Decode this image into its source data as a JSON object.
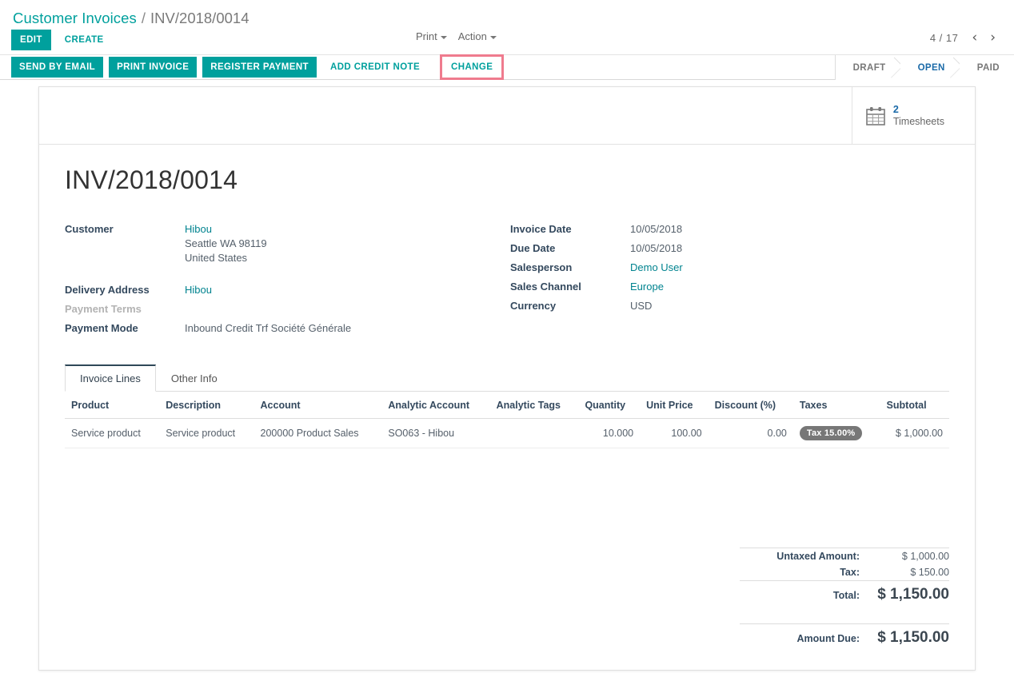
{
  "breadcrumb": {
    "root": "Customer Invoices",
    "separator": "/",
    "current": "INV/2018/0014"
  },
  "control_panel": {
    "edit_label": "EDIT",
    "create_label": "CREATE",
    "print_label": "Print",
    "action_label": "Action",
    "pager_value": "4 / 17",
    "pager_prev_icon": "‹",
    "pager_next_icon": "›"
  },
  "workflow_buttons": [
    {
      "label": "SEND BY EMAIL",
      "style": "solid",
      "highlighted": false
    },
    {
      "label": "PRINT INVOICE",
      "style": "solid",
      "highlighted": false
    },
    {
      "label": "REGISTER PAYMENT",
      "style": "solid",
      "highlighted": false
    },
    {
      "label": "ADD CREDIT NOTE",
      "style": "flat",
      "highlighted": false
    },
    {
      "label": "CHANGE",
      "style": "flat",
      "highlighted": true
    }
  ],
  "statusbar": {
    "states": [
      "DRAFT",
      "OPEN",
      "PAID"
    ],
    "active": "OPEN",
    "active_color": "#1a6aa8"
  },
  "stat_buttons": [
    {
      "icon": "calendar-icon",
      "value": "2",
      "label": "Timesheets"
    }
  ],
  "record": {
    "title": "INV/2018/0014",
    "left_fields": [
      {
        "label": "Customer",
        "value": "Hibou",
        "link": true,
        "extra_lines": [
          "Seattle WA 98119",
          "United States"
        ]
      },
      {
        "label": "Delivery Address",
        "value": "Hibou",
        "link": true,
        "extra_lines": []
      },
      {
        "label": "Payment Terms",
        "value": "",
        "link": false,
        "muted_label": true,
        "extra_lines": []
      },
      {
        "label": "Payment Mode",
        "value": "Inbound Credit Trf Société Générale",
        "link": false,
        "extra_lines": []
      }
    ],
    "right_fields": [
      {
        "label": "Invoice Date",
        "value": "10/05/2018",
        "link": false
      },
      {
        "label": "Due Date",
        "value": "10/05/2018",
        "link": false
      },
      {
        "label": "Salesperson",
        "value": "Demo User",
        "link": true
      },
      {
        "label": "Sales Channel",
        "value": "Europe",
        "link": true
      },
      {
        "label": "Currency",
        "value": "USD",
        "link": false
      }
    ]
  },
  "notebook": {
    "tabs": [
      {
        "label": "Invoice Lines",
        "active": true
      },
      {
        "label": "Other Info",
        "active": false
      }
    ]
  },
  "lines_table": {
    "columns": [
      {
        "label": "Product",
        "align": "left"
      },
      {
        "label": "Description",
        "align": "left"
      },
      {
        "label": "Account",
        "align": "left"
      },
      {
        "label": "Analytic Account",
        "align": "left"
      },
      {
        "label": "Analytic Tags",
        "align": "left"
      },
      {
        "label": "Quantity",
        "align": "right"
      },
      {
        "label": "Unit Price",
        "align": "right"
      },
      {
        "label": "Discount (%)",
        "align": "right"
      },
      {
        "label": "Taxes",
        "align": "left"
      },
      {
        "label": "Subtotal",
        "align": "right"
      }
    ],
    "rows": [
      {
        "product": "Service product",
        "description": "Service product",
        "account": "200000 Product Sales",
        "analytic_account": "SO063 - Hibou",
        "analytic_tags": "",
        "quantity": "10.000",
        "unit_price": "100.00",
        "discount": "0.00",
        "taxes": "Tax 15.00%",
        "subtotal": "$ 1,000.00"
      }
    ]
  },
  "totals": [
    {
      "label": "Untaxed Amount:",
      "value": "$ 1,000.00",
      "big": false
    },
    {
      "label": "Tax:",
      "value": "$ 150.00",
      "big": false
    },
    {
      "label": "Total:",
      "value": "$ 1,150.00",
      "big": true
    },
    {
      "label": "Amount Due:",
      "value": "$ 1,150.00",
      "big": true,
      "spaced": true
    }
  ],
  "colors": {
    "accent_teal": "#00a09d",
    "link_teal": "#00838f",
    "status_blue": "#1a6aa8",
    "highlight_pink": "#ef7b8e",
    "tax_badge_grey": "#777777"
  }
}
